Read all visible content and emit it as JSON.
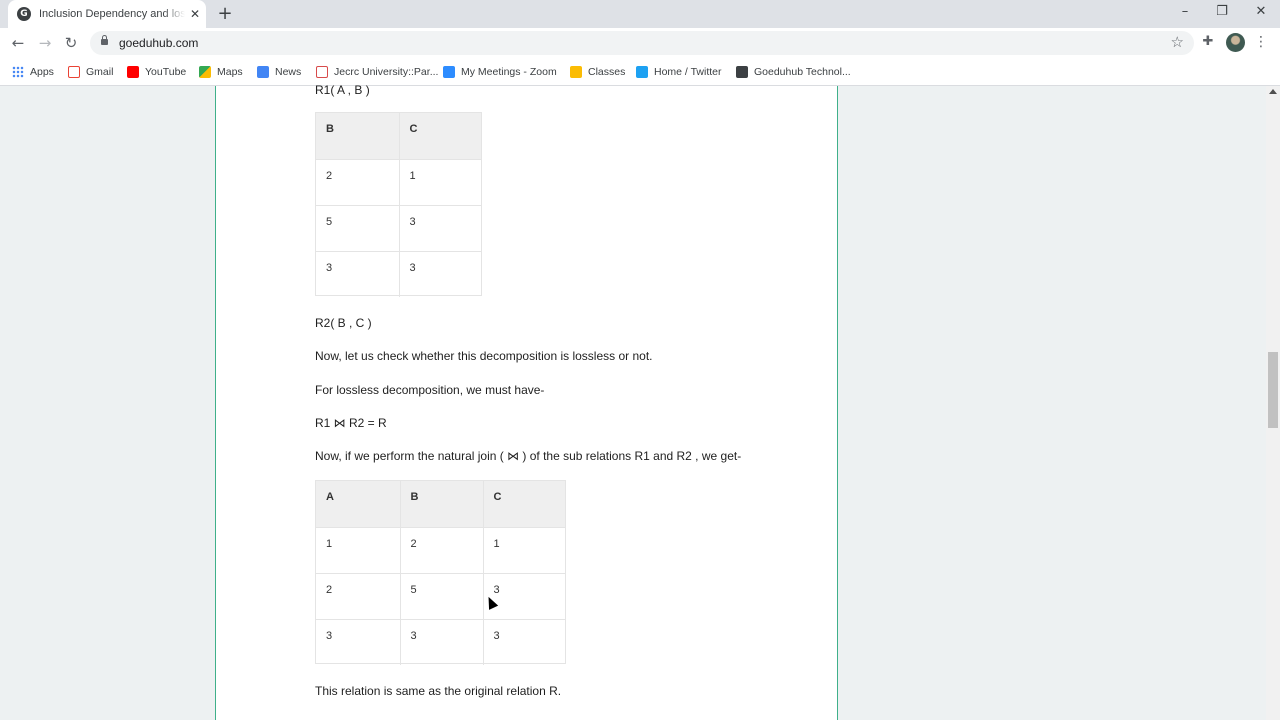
{
  "browser": {
    "tab_title": "Inclusion Dependency and lossless",
    "tab_favicon_letter": "G",
    "url": "goeduhub.com",
    "bookmarks": [
      {
        "label": "Apps",
        "icon": "apps-icon"
      },
      {
        "label": "Gmail",
        "icon": "gmail-icon"
      },
      {
        "label": "YouTube",
        "icon": "youtube-icon"
      },
      {
        "label": "Maps",
        "icon": "maps-icon"
      },
      {
        "label": "News",
        "icon": "news-icon"
      },
      {
        "label": "Jecrc University::Par...",
        "icon": "jecrc-icon"
      },
      {
        "label": "My Meetings - Zoom",
        "icon": "zoom-icon"
      },
      {
        "label": "Classes",
        "icon": "classes-icon"
      },
      {
        "label": "Home / Twitter",
        "icon": "twitter-icon"
      },
      {
        "label": "Goeduhub Technol...",
        "icon": "goeduhub-icon"
      }
    ]
  },
  "article": {
    "r1_heading": "R1( A , B )",
    "table1": {
      "headers": [
        "B",
        "C"
      ],
      "rows": [
        [
          "2",
          "1"
        ],
        [
          "5",
          "3"
        ],
        [
          "3",
          "3"
        ]
      ]
    },
    "r2_heading": "R2( B , C )",
    "p_check": " Now, let us check whether this decomposition is lossless or not.",
    "p_lossless": "For lossless decomposition, we must have-",
    "p_formula": "R1 ⋈ R2 = R",
    "p_join": " Now, if we perform the natural join ( ⋈ ) of the sub relations R1 and R2 , we get-",
    "table2": {
      "headers": [
        "A",
        "B",
        "C"
      ],
      "rows": [
        [
          "1",
          "2",
          "1"
        ],
        [
          "2",
          "5",
          "3"
        ],
        [
          "3",
          "3",
          "3"
        ]
      ]
    },
    "p_conclusion": "This relation is same as the original relation R."
  }
}
